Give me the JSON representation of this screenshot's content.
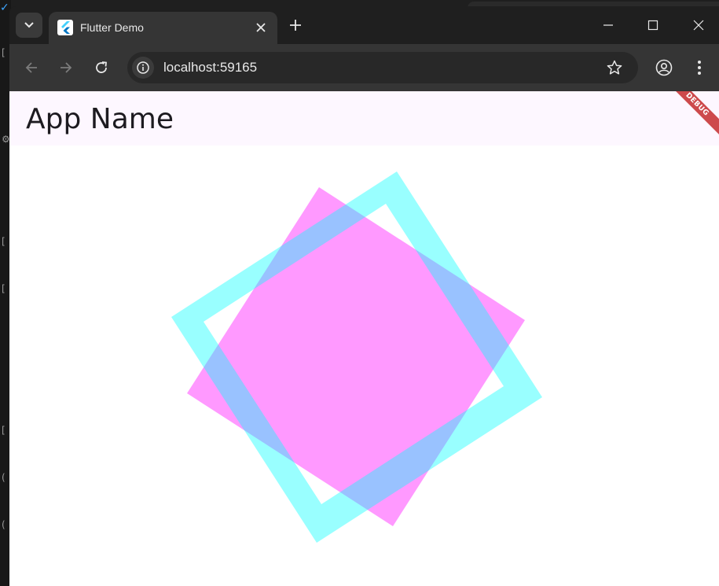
{
  "browser": {
    "tab_title": "Flutter Demo",
    "url": "localhost:59165"
  },
  "app": {
    "title": "App Name",
    "debug_label": "DEBUG"
  },
  "colors": {
    "appbar_background": "#fdf7ff",
    "square_magenta": "#ff00ff",
    "square_cyan": "#00ffff",
    "debug_banner": "#b00000"
  },
  "icons": {
    "tab_search": "chevron-down-icon",
    "favicon": "flutter-logo-icon",
    "tab_close": "close-icon",
    "new_tab": "plus-icon",
    "back": "arrow-left-icon",
    "forward": "arrow-right-icon",
    "reload": "reload-icon",
    "site_info": "info-icon",
    "bookmark": "star-icon",
    "profile": "account-circle-icon",
    "menu": "kebab-menu-icon"
  }
}
